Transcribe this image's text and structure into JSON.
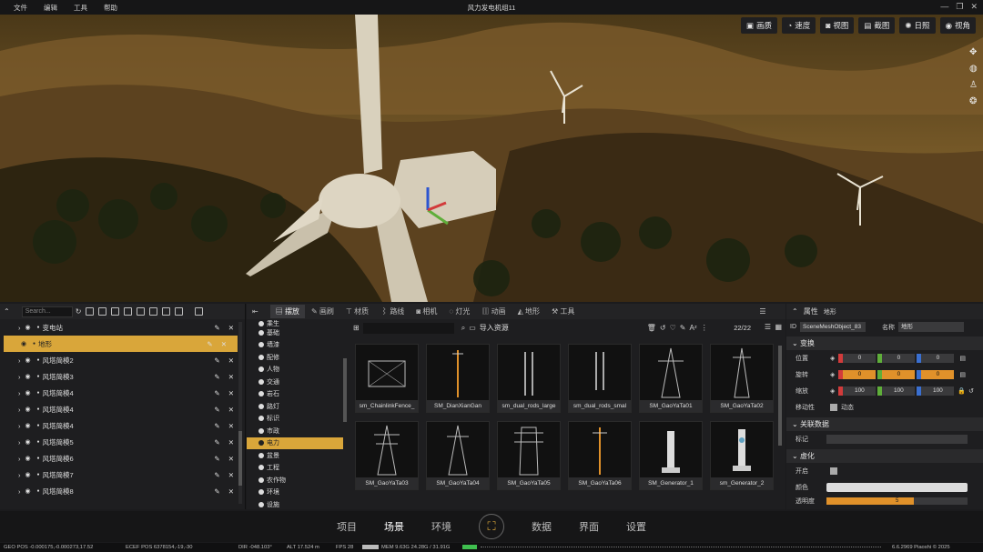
{
  "menu": [
    "文件",
    "编辑",
    "工具",
    "帮助"
  ],
  "window_title": "风力发电机组11",
  "viewport_toolbar": [
    {
      "icon": "image-icon",
      "label": "画质"
    },
    {
      "icon": "speed-icon",
      "label": "速度"
    },
    {
      "icon": "camera-view-icon",
      "label": "视图"
    },
    {
      "icon": "screenshot-icon",
      "label": "截图"
    },
    {
      "icon": "sun-icon",
      "label": "日照"
    },
    {
      "icon": "eye-icon",
      "label": "视角"
    }
  ],
  "outliner": {
    "search_placeholder": "Search...",
    "items": [
      "变电站",
      "地形",
      "风塔简模2",
      "风塔简模3",
      "风塔简模4",
      "风塔简模4",
      "风塔简模4",
      "风塔简模5",
      "风塔简模6",
      "风塔简模7",
      "风塔简模8"
    ],
    "selected_index": 1
  },
  "asset_tabs": [
    "摆放",
    "画刷",
    "材质",
    "路线",
    "相机",
    "灯光",
    "动画",
    "地形",
    "工具"
  ],
  "categories": [
    "乘生",
    "基础",
    "墙漆",
    "配修",
    "人物",
    "交通",
    "岩石",
    "路灯",
    "标识",
    "市政",
    "电力",
    "盆景",
    "工程",
    "农作物",
    "环境",
    "设施"
  ],
  "selected_category": "电力",
  "asset_toolbar": {
    "import_label": "导入资源",
    "count": "22/22"
  },
  "assets": [
    "sm_ChainlinkFence_",
    "SM_DianXianGan",
    "sm_dual_rods_large",
    "sm_dual_rods_smal",
    "SM_GaoYaTa01",
    "SM_GaoYaTa02",
    "SM_GaoYaTa03",
    "SM_GaoYaTa04",
    "SM_GaoYaTa05",
    "SM_GaoYaTa06",
    "SM_Generator_1",
    "sm_Generator_2"
  ],
  "properties": {
    "header": "属性",
    "header_sub": "地形",
    "id_label": "ID",
    "id_value": "SceneMeshObject_83",
    "name_label": "名称",
    "name_value": "地形",
    "transform_section": "变换",
    "position_label": "位置",
    "position": [
      "0",
      "0",
      "0"
    ],
    "rotation_label": "旋转",
    "rotation": [
      "0",
      "0",
      "0"
    ],
    "scale_label": "缩放",
    "scale": [
      "100",
      "100",
      "100"
    ],
    "mobility_label": "移动性",
    "mobility_value": "动态",
    "related_section": "关联数据",
    "tag_label": "标记",
    "virtual_section": "虚化",
    "enable_label": "开启",
    "color_label": "颜色",
    "opacity_label": "透明度",
    "opacity_value": "5",
    "opacity_fraction": 0.62
  },
  "bottom_nav": {
    "items": [
      "项目",
      "场景",
      "环境",
      "数据",
      "界面",
      "设置"
    ],
    "active": "场景"
  },
  "status": {
    "geo": "GEO POS  -0.000175,-0.000273,17.52",
    "ecef": "ECEF POS  6378154,-19,-30",
    "dir": "DIR  -048.103°",
    "alt": "ALT  17.524 m",
    "fps": "FPS  28",
    "mem": "MEM  9.63G  24.28G / 31.91G",
    "version": "6.6.2969  Piaoshi © 2025"
  },
  "colors": {
    "accent": "#d9a63a",
    "orange": "#e0912a",
    "x_axis": "#d23b3b",
    "y_axis": "#5fae3a",
    "z_axis": "#3a6fd0"
  }
}
